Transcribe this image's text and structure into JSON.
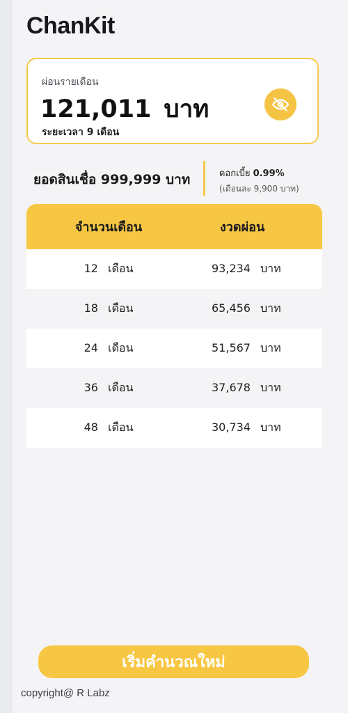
{
  "app": {
    "title": "ChanKit"
  },
  "summary": {
    "label": "ผ่อนรายเดือน",
    "amount": "121,011",
    "unit": "บาท",
    "period": "ระยะเวลา 9 เดือน",
    "toggle_icon": "eye-slash-icon"
  },
  "loan": {
    "total_text": "ยอดสินเชื่อ 999,999 บาท",
    "interest_label": "ดอกเบี้ย",
    "interest_rate": "0.99%",
    "interest_monthly": "(เดือนละ 9,900 บาท)"
  },
  "table": {
    "headers": [
      "จำนวนเดือน",
      "งวดผ่อน"
    ],
    "rows": [
      {
        "months": "12",
        "month_unit": "เดือน",
        "payment": "93,234",
        "payment_unit": "บาท"
      },
      {
        "months": "18",
        "month_unit": "เดือน",
        "payment": "65,456",
        "payment_unit": "บาท"
      },
      {
        "months": "24",
        "month_unit": "เดือน",
        "payment": "51,567",
        "payment_unit": "บาท"
      },
      {
        "months": "36",
        "month_unit": "เดือน",
        "payment": "37,678",
        "payment_unit": "บาท"
      },
      {
        "months": "48",
        "month_unit": "เดือน",
        "payment": "30,734",
        "payment_unit": "บาท"
      }
    ]
  },
  "actions": {
    "restart_label": "เริ่มคำนวณใหม่"
  },
  "footer": {
    "copyright": "copyright@ R Labz"
  },
  "colors": {
    "accent": "#f7c744",
    "background": "#f4f4f6",
    "text": "#1e1f24"
  }
}
